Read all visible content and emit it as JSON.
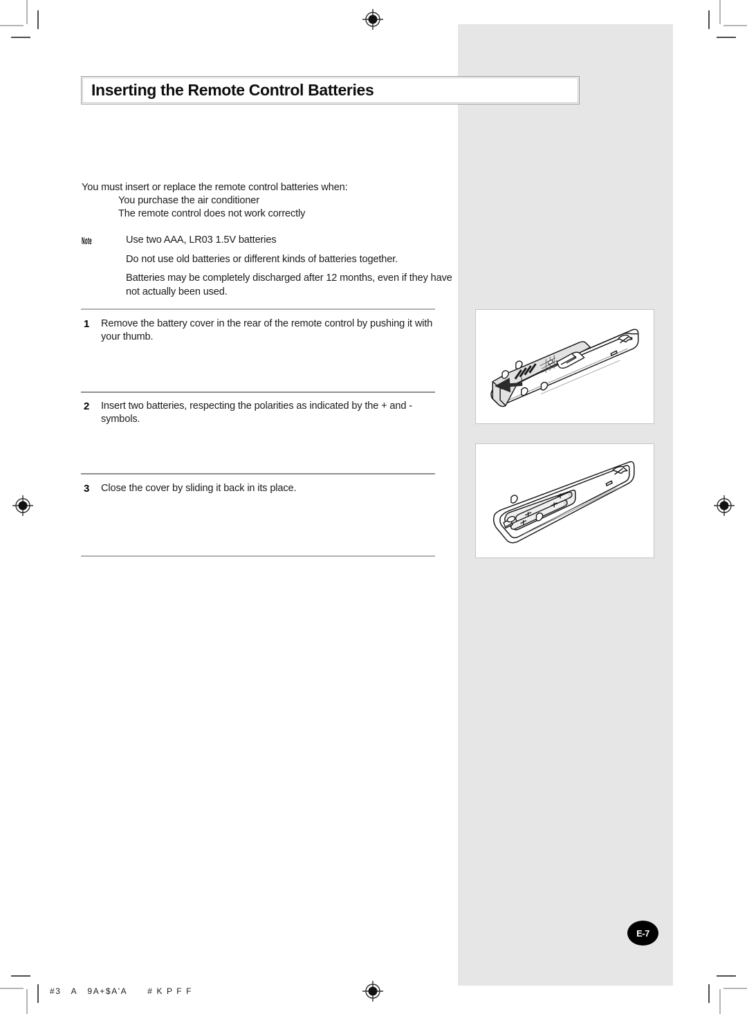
{
  "page": {
    "title": "Inserting the Remote Control Batteries",
    "page_number_badge": "E-7",
    "footer_text": "#3   A   9A+$A'A      # K P F F",
    "panel_color": "#e6e6e6",
    "title_border_color": "#9a9a9a",
    "rule_color": "#b0b0b0",
    "badge_color": "#000000"
  },
  "intro": {
    "lead": "You must insert or replace the remote control batteries when:",
    "conditions": [
      "You purchase the air conditioner",
      "The remote control does not work correctly"
    ]
  },
  "note": {
    "label": "Note",
    "items": [
      "Use two AAA, LR03 1.5V batteries",
      "Do not use old batteries or different kinds of batteries together.",
      "Batteries may be completely discharged after 12 months, even if they have not actually been used."
    ]
  },
  "steps": [
    {
      "number": "1",
      "text": "Remove the battery cover in the rear of the remote control by pushing it with your thumb."
    },
    {
      "number": "2",
      "text": "Insert two batteries, respecting the polarities as indicated by the + and - symbols."
    },
    {
      "number": "3",
      "text": "Close the cover by sliding it back in its place."
    }
  ],
  "illustrations": [
    {
      "name": "remote-cover-removal",
      "description": "Rear of remote control with battery cover sliding off, arrow indicating push direction"
    },
    {
      "name": "remote-battery-compartment",
      "description": "Open battery compartment of remote control with two AAA batteries inserted"
    }
  ],
  "marks": {
    "registration_icon": "registration-target",
    "crop_mark": "crop-mark"
  }
}
